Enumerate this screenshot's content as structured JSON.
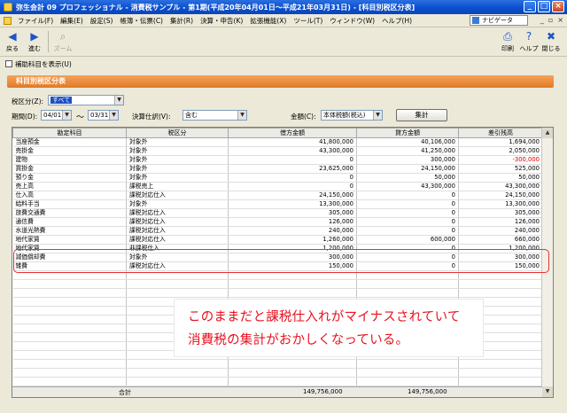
{
  "window": {
    "title": "弥生会計 09 プロフェッショナル - 消費税サンプル - 第1期(平成20年04月01日～平成21年03月31日) - [科目別税区分表]",
    "btn_min": "_",
    "btn_max": "□",
    "btn_close": "×"
  },
  "menubar": {
    "items": [
      "ファイル(F)",
      "編集(E)",
      "設定(S)",
      "帳簿・伝票(C)",
      "集計(R)",
      "決算・申告(K)",
      "拡張機能(X)",
      "ツール(T)",
      "ウィンドウ(W)",
      "ヘルプ(H)"
    ],
    "navi_label": "ナビゲータ",
    "mdi_min": "_",
    "mdi_restore": "▫",
    "mdi_close": "×"
  },
  "toolbar": {
    "back": "戻る",
    "forward": "進む",
    "zoom": "ズーム",
    "print": "印刷",
    "help": "ヘルプ",
    "close": "閉じる"
  },
  "aux_checkbox_label": "補助科目を表示(U)",
  "panel_title": "科目別税区分表",
  "filters": {
    "tax_type_label": "税区分(Z):",
    "tax_type_value": "すべて",
    "period_label": "期間(D):",
    "period_from": "04/01",
    "period_sep": "～",
    "period_to": "03/31",
    "settlement_label": "決算仕訳(V):",
    "settlement_value": "含む",
    "amount_label": "金額(C):",
    "amount_value": "本体税額(税込)",
    "aggregate_button": "集計"
  },
  "table": {
    "headers": [
      "勘定科目",
      "税区分",
      "借方金額",
      "貸方金額",
      "差引残高"
    ],
    "rows": [
      {
        "account": "当座預金",
        "tax": "対象外",
        "debit": "41,800,000",
        "credit": "40,106,000",
        "balance": "1,694,000",
        "negative": false
      },
      {
        "account": "売掛金",
        "tax": "対象外",
        "debit": "43,300,000",
        "credit": "41,250,000",
        "balance": "2,050,000",
        "negative": false
      },
      {
        "account": "建物",
        "tax": "対象外",
        "debit": "0",
        "credit": "300,000",
        "balance": "-300,000",
        "negative": true
      },
      {
        "account": "買掛金",
        "tax": "対象外",
        "debit": "23,625,000",
        "credit": "24,150,000",
        "balance": "525,000",
        "negative": false
      },
      {
        "account": "預り金",
        "tax": "対象外",
        "debit": "0",
        "credit": "50,000",
        "balance": "50,000",
        "negative": false
      },
      {
        "account": "売上高",
        "tax": "課税売上",
        "debit": "0",
        "credit": "43,300,000",
        "balance": "43,300,000",
        "negative": false
      },
      {
        "account": "仕入高",
        "tax": "課税対応仕入",
        "debit": "24,150,000",
        "credit": "0",
        "balance": "24,150,000",
        "negative": false
      },
      {
        "account": "給料手当",
        "tax": "対象外",
        "debit": "13,300,000",
        "credit": "0",
        "balance": "13,300,000",
        "negative": false
      },
      {
        "account": "旅費交通費",
        "tax": "課税対応仕入",
        "debit": "305,000",
        "credit": "0",
        "balance": "305,000",
        "negative": false
      },
      {
        "account": "通信費",
        "tax": "課税対応仕入",
        "debit": "126,000",
        "credit": "0",
        "balance": "126,000",
        "negative": false
      },
      {
        "account": "水道光熱費",
        "tax": "課税対応仕入",
        "debit": "240,000",
        "credit": "0",
        "balance": "240,000",
        "negative": false
      },
      {
        "account": "地代家賃",
        "tax": "課税対応仕入",
        "debit": "1,260,000",
        "credit": "600,000",
        "balance": "660,000",
        "negative": false
      },
      {
        "account": "地代家賃",
        "tax": "非課税仕入",
        "debit": "1,200,000",
        "credit": "0",
        "balance": "1,200,000",
        "negative": false
      },
      {
        "account": "減価償却費",
        "tax": "対象外",
        "debit": "300,000",
        "credit": "0",
        "balance": "300,000",
        "negative": false
      },
      {
        "account": "雑費",
        "tax": "課税対応仕入",
        "debit": "150,000",
        "credit": "0",
        "balance": "150,000",
        "negative": false
      }
    ],
    "total_label": "合計",
    "total_debit": "149,756,000",
    "total_credit": "149,756,000"
  },
  "annotation": {
    "line1": "このままだと課税仕入れがマイナスされていて",
    "line2": "消費税の集計がおかしくなっている。",
    "color": "#e8101e"
  }
}
